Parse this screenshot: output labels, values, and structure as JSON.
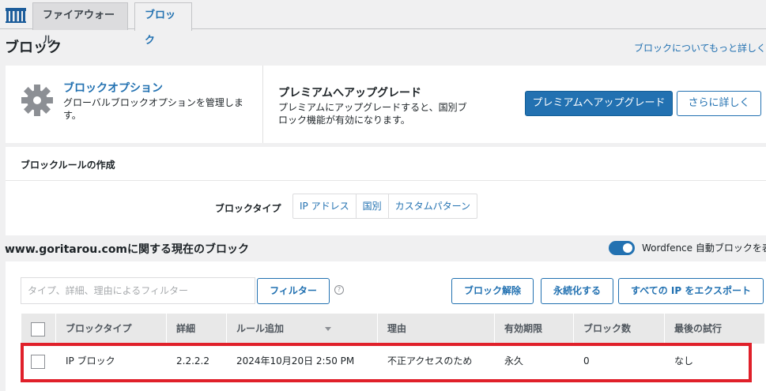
{
  "tabs": [
    {
      "label": "ファイアウォール",
      "active": false
    },
    {
      "label": "ブロック",
      "active": true
    }
  ],
  "header": {
    "title": "ブロック",
    "learn_more": "ブロックについてもっと詳しく"
  },
  "options": {
    "title": "ブロックオプション",
    "description": "グローバルブロックオプションを管理します。"
  },
  "upgrade": {
    "title": "プレミアムへアップグレード",
    "description": "プレミアムにアップグレードすると、国別ブロック機能が有効になります。",
    "premium_button": "プレミアムへアップグレード",
    "more_button": "さらに詳しく"
  },
  "rule": {
    "heading": "ブロックルールの作成",
    "type_label": "ブロックタイプ",
    "types": [
      "IP アドレス",
      "国別",
      "カスタムパターン"
    ]
  },
  "current": {
    "title": "www.goritarou.comに関する現在のブロック",
    "auto_block_label": "Wordfence 自動ブロックを表",
    "auto_block_enabled": true
  },
  "toolbar": {
    "filter_placeholder": "タイプ、詳細、理由によるフィルター",
    "filter_button": "フィルター",
    "unblock_button": "ブロック解除",
    "permanent_button": "永続化する",
    "export_button": "すべての IP をエクスポート"
  },
  "table": {
    "columns": [
      "ブロックタイプ",
      "詳細",
      "ルール追加",
      "理由",
      "有効期限",
      "ブロック数",
      "最後の試行"
    ],
    "rows": [
      [
        "IP ブロック",
        "2.2.2.2",
        "2024年10月20日 2:50 PM",
        "不正アクセスのため",
        "永久",
        "0",
        "なし"
      ]
    ]
  },
  "colors": {
    "accent": "#2271b1",
    "highlight": "#e0202a"
  },
  "icons": [
    "wordfence-logo-icon",
    "gear-icon",
    "help-icon",
    "sort-arrow-icon"
  ]
}
